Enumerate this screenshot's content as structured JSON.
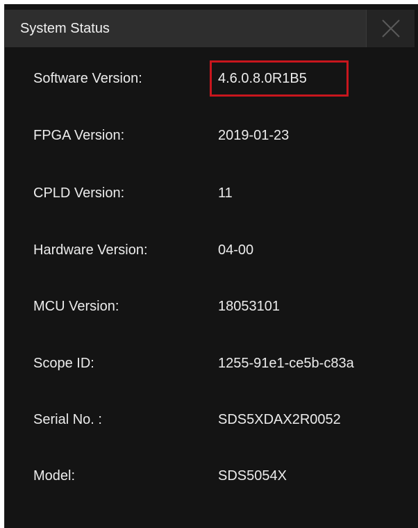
{
  "dialog": {
    "title": "System Status",
    "close_icon": "close-icon"
  },
  "rows": [
    {
      "label": "Software Version:",
      "value": "4.6.0.8.0R1B5"
    },
    {
      "label": "FPGA Version:",
      "value": "2019-01-23"
    },
    {
      "label": "CPLD Version:",
      "value": "11"
    },
    {
      "label": "Hardware Version:",
      "value": "04-00"
    },
    {
      "label": "MCU Version:",
      "value": "18053101"
    },
    {
      "label": "Scope ID:",
      "value": "1255-91e1-ce5b-c83a"
    },
    {
      "label": "Serial No. :",
      "value": "SDS5XDAX2R0052"
    },
    {
      "label": "Model:",
      "value": "SDS5054X"
    }
  ],
  "colors": {
    "background": "#141414",
    "titlebar": "#2e2e2e",
    "text": "#ececec",
    "highlight": "#c8161d"
  }
}
